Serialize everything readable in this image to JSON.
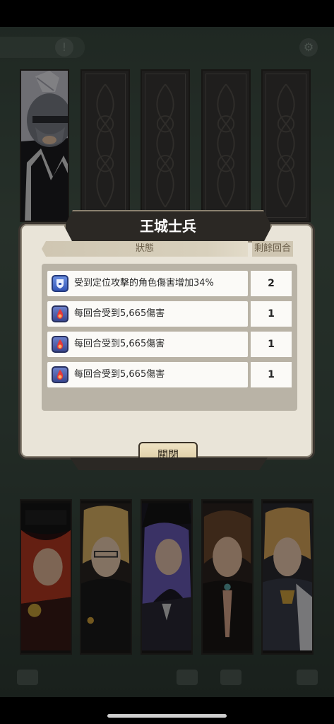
{
  "dialog": {
    "title": "王城士兵",
    "header_status": "狀態",
    "header_turns": "剩餘回合",
    "effects": [
      {
        "text": "受到定位攻擊的角色傷害增加34%",
        "turns": "2",
        "icon": "shield-debuff-icon"
      },
      {
        "text": "每回合受到5,665傷害",
        "turns": "1",
        "icon": "burn-icon"
      },
      {
        "text": "每回合受到5,665傷害",
        "turns": "1",
        "icon": "burn-icon"
      },
      {
        "text": "每回合受到5,665傷害",
        "turns": "1",
        "icon": "burn-icon"
      }
    ],
    "close_label": "關閉"
  },
  "colors": {
    "dialog_bg": "#e9e4d8",
    "title_plate": "#2b2824",
    "button_gold": "#d9c79c"
  }
}
